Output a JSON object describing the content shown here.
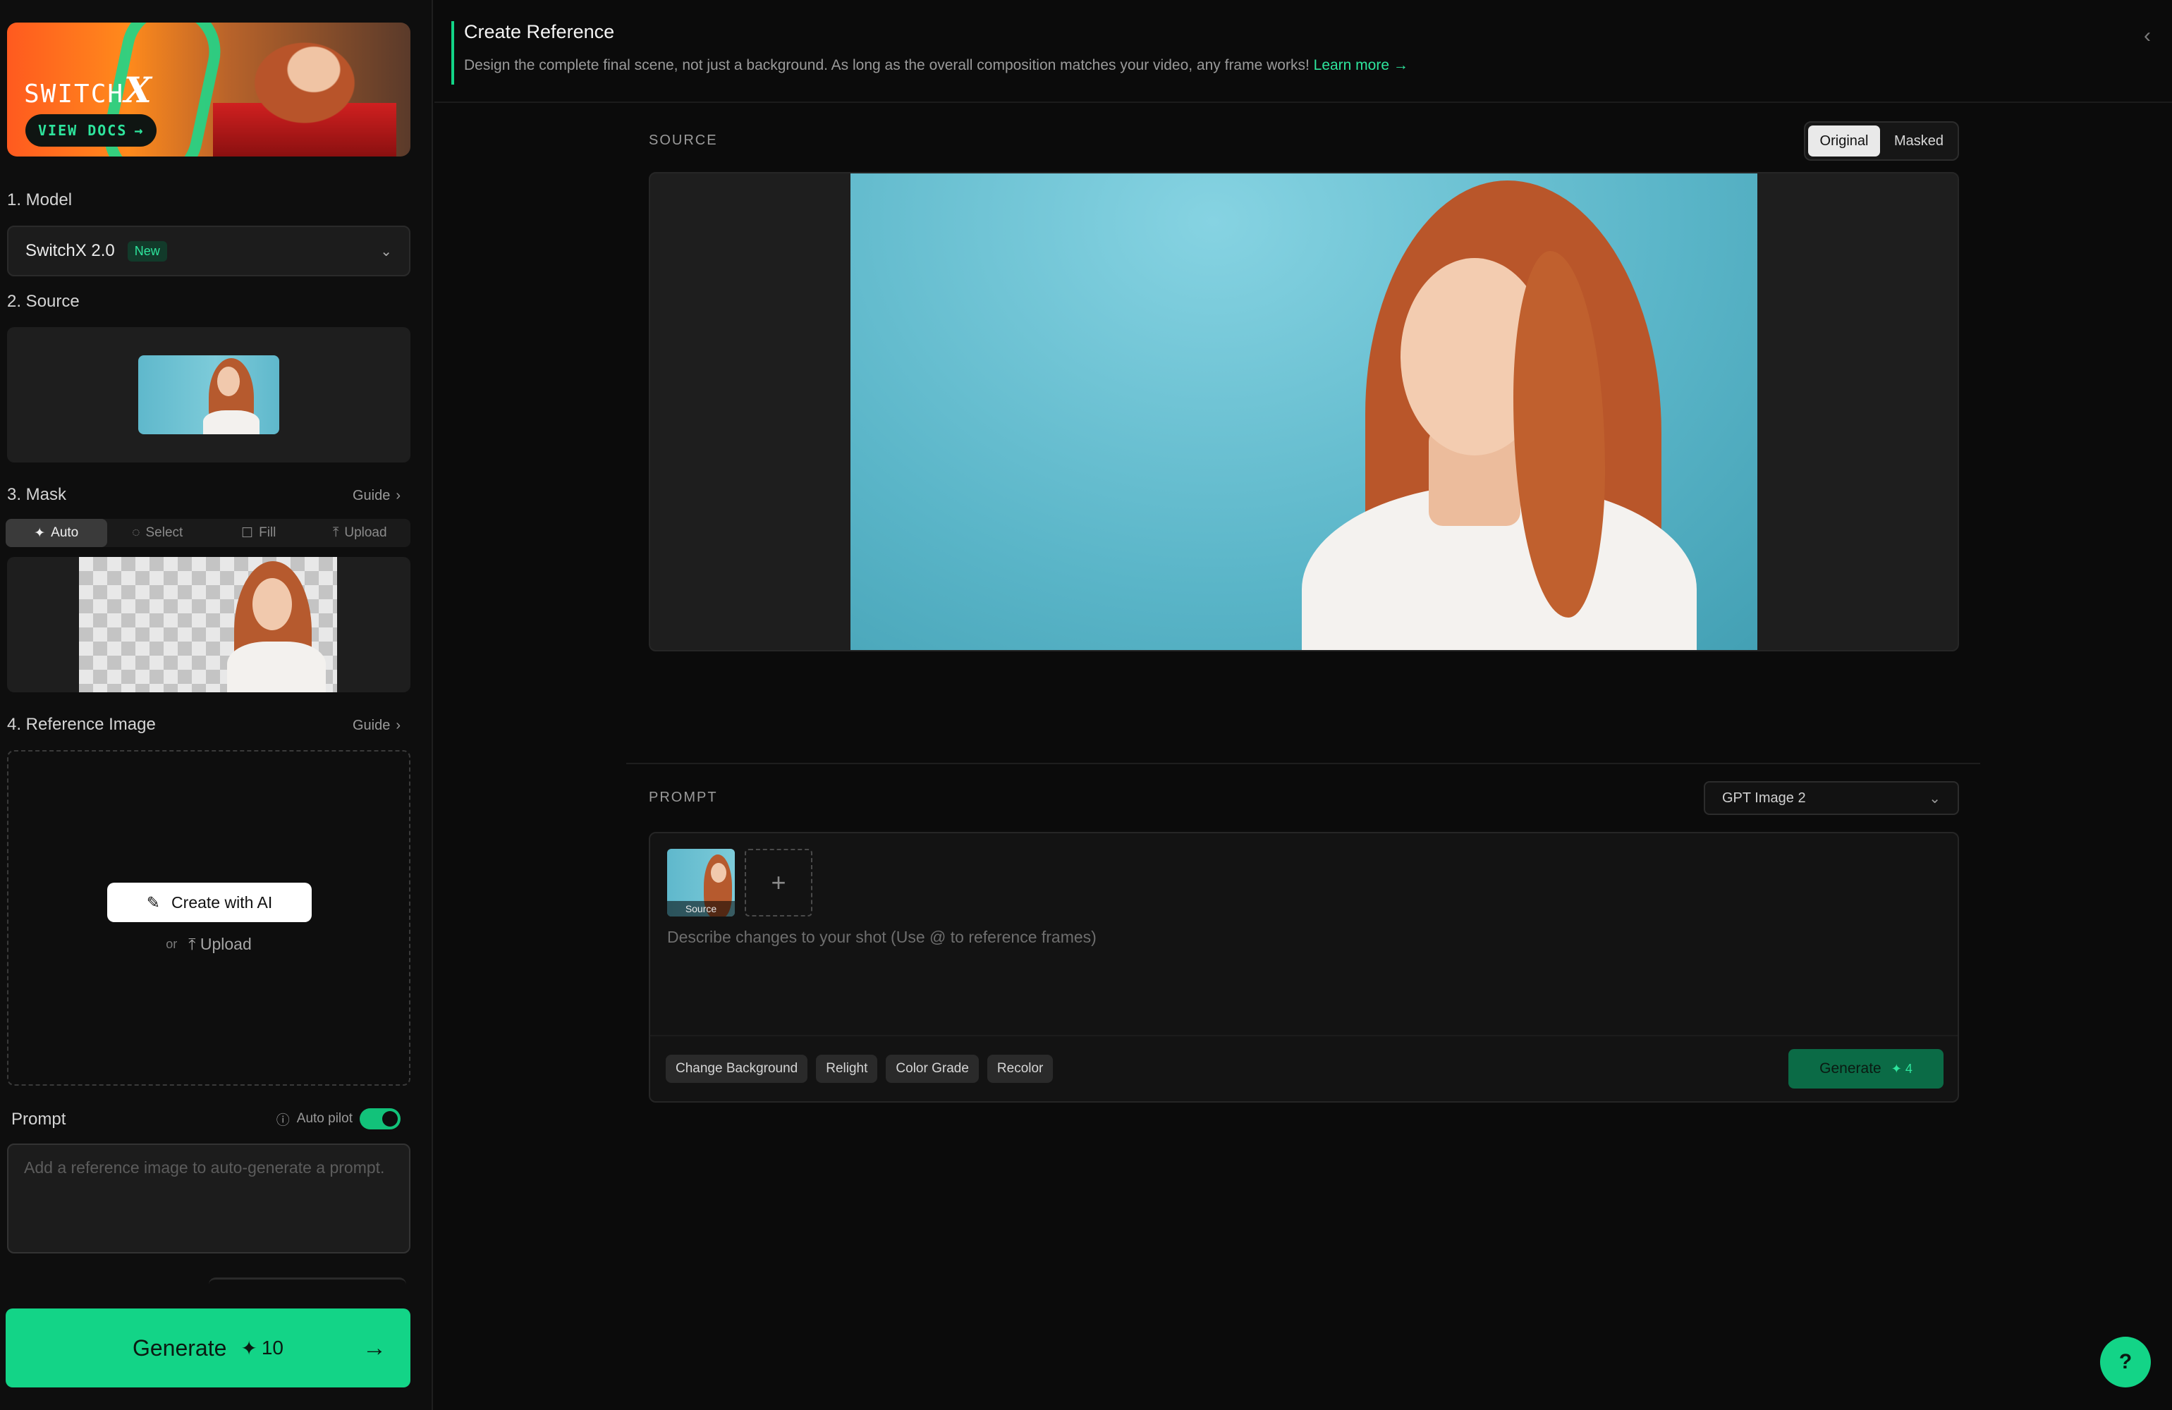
{
  "sidebar": {
    "banner": {
      "brand_text": "SWITCH",
      "brand_mark": "X",
      "docs_label": "VIEW DOCS",
      "docs_icon": "arrow-right-icon"
    },
    "model": {
      "label": "1. Model",
      "value": "SwitchX 2.0",
      "badge": "New"
    },
    "source": {
      "label": "2. Source"
    },
    "mask": {
      "label": "3. Mask",
      "guide": "Guide",
      "tabs": [
        {
          "label": "Auto",
          "icon": "magic-wand-icon"
        },
        {
          "label": "Select",
          "icon": "lasso-icon"
        },
        {
          "label": "Fill",
          "icon": "square-icon"
        },
        {
          "label": "Upload",
          "icon": "upload-icon"
        }
      ]
    },
    "reference": {
      "label": "4. Reference Image",
      "guide": "Guide",
      "create_label": "Create with AI",
      "or_label": "or",
      "upload_label": "Upload"
    },
    "prompt": {
      "label": "Prompt",
      "autopilot_label": "Auto pilot",
      "autopilot_on": true,
      "placeholder": "Add a reference image to auto-generate a prompt."
    },
    "generate": {
      "label": "Generate",
      "credits": "10"
    }
  },
  "main": {
    "title": "Create Reference",
    "subtitle": "Design the complete final scene, not just a background. As long as the overall composition matches your video, any frame works!",
    "learn_more": "Learn more →",
    "source_label": "SOURCE",
    "view_toggle": {
      "options": [
        "Original",
        "Masked"
      ],
      "selected": "Original"
    },
    "prompt_label": "PROMPT",
    "image_model": "GPT Image 2",
    "source_thumb_caption": "Source",
    "prompt_placeholder": "Describe changes to your shot (Use @ to reference frames)",
    "chips": [
      "Change Background",
      "Relight",
      "Color Grade",
      "Recolor"
    ],
    "generate": {
      "label": "Generate",
      "credits": "4"
    },
    "help_label": "?"
  },
  "colors": {
    "accent": "#13d487",
    "accent_text": "#2ee59d",
    "background": "#0b0b0b"
  }
}
